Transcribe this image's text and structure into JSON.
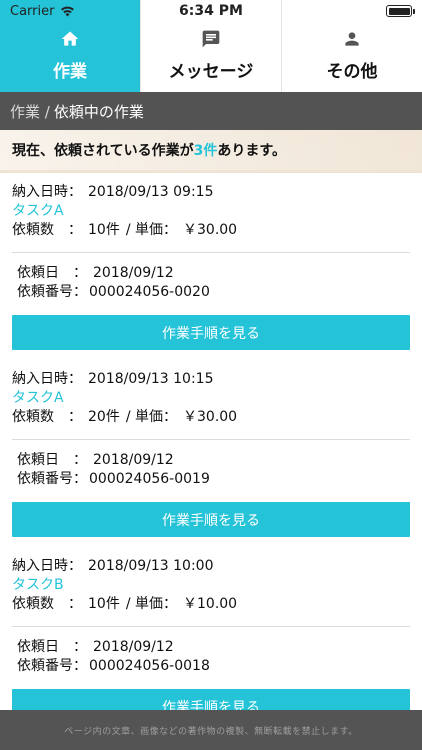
{
  "status_bar": {
    "carrier": "Carrier",
    "time": "6:34 PM"
  },
  "tabs": [
    {
      "label": "作業",
      "icon": "home-icon",
      "active": true
    },
    {
      "label": "メッセージ",
      "icon": "message-icon",
      "active": false
    },
    {
      "label": "その他",
      "icon": "person-icon",
      "active": false
    }
  ],
  "breadcrumb": {
    "first": "作業 /",
    "current": "依頼中の作業"
  },
  "summary": {
    "prefix": "現在、依頼されている作業が",
    "count": "3件",
    "suffix": "あります。"
  },
  "labels": {
    "delivery": "納入日時：",
    "quantity": "依頼数　：",
    "unit_price_sep": "/ 単価：",
    "request_date": "依頼日　：",
    "request_number": "依頼番号：",
    "button": "作業手順を見る"
  },
  "orders": [
    {
      "delivery": "2018/09/13 09:15",
      "task": "タスクA",
      "quantity": "10件",
      "unit_price": "￥30.00",
      "request_date": "2018/09/12",
      "request_number": "000024056-0020"
    },
    {
      "delivery": "2018/09/13 10:15",
      "task": "タスクA",
      "quantity": "20件",
      "unit_price": "￥30.00",
      "request_date": "2018/09/12",
      "request_number": "000024056-0019"
    },
    {
      "delivery": "2018/09/13 10:00",
      "task": "タスクB",
      "quantity": "10件",
      "unit_price": "￥10.00",
      "request_date": "2018/09/12",
      "request_number": "000024056-0018"
    }
  ],
  "footer": {
    "notice": "ページ内の文章、画像などの著作物の複製、無断転載を禁止します。"
  },
  "colors": {
    "accent": "#24c3d8",
    "breadcrumb_bg": "#535353",
    "footer_bg": "#545454"
  }
}
